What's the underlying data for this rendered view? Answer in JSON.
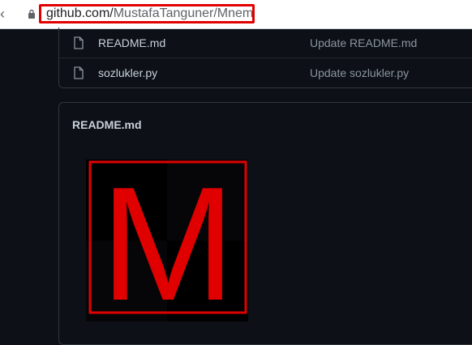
{
  "browser": {
    "url_host": "github.com/",
    "url_path": "MustafaTanguner/Mnemonic"
  },
  "files": [
    {
      "name": "README.md",
      "commit": "Update README.md"
    },
    {
      "name": "sozlukler.py",
      "commit": "Update sozlukler.py"
    }
  ],
  "readme": {
    "title": "README.md",
    "logo_letter": "M"
  },
  "colors": {
    "accent_red": "#e10000",
    "bg": "#0d1117"
  }
}
